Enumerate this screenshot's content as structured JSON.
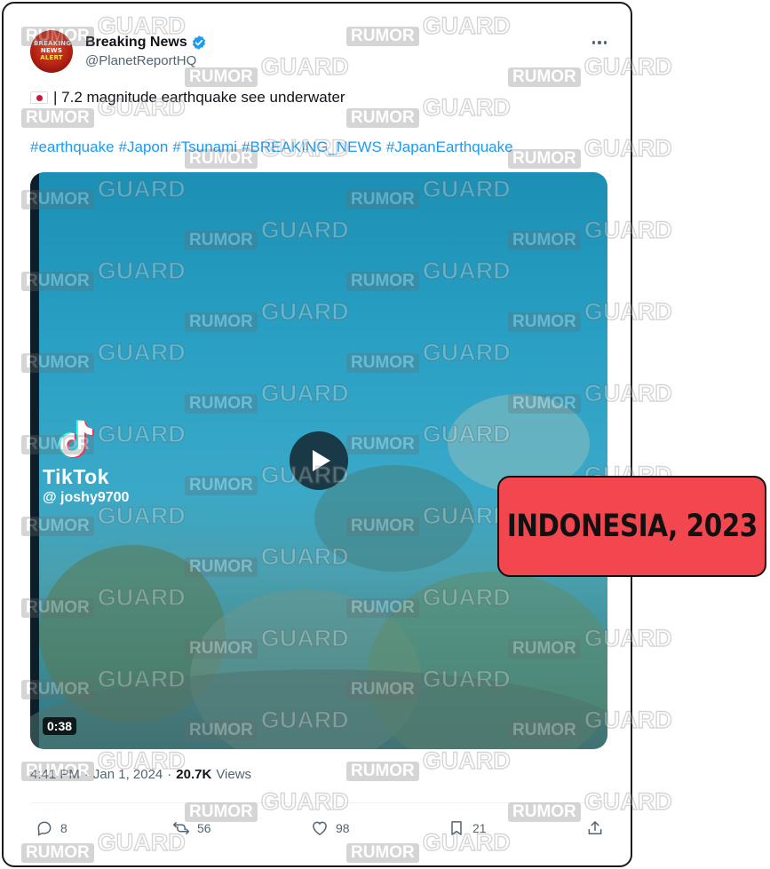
{
  "post": {
    "author": {
      "display_name": "Breaking News",
      "handle": "@PlanetReportHQ",
      "verified": true,
      "avatar_lines": [
        "BREAKING",
        "NEWS",
        "ALERT"
      ]
    },
    "text": "| 7.2 magnitude earthquake see underwater",
    "flag_icon": "japan-flag-icon",
    "hashtags": [
      "#earthquake",
      "#Japon",
      "#Tsunami",
      "#BREAKING_NEWS",
      "#JapanEarthquake"
    ],
    "media": {
      "tiktok_label": "TikTok",
      "tiktok_user": "@ joshy9700",
      "duration": "0:38"
    },
    "meta": {
      "time": "4:41 PM",
      "separator": "·",
      "date": "Jan 1, 2024",
      "views_count": "20.7K",
      "views_label": "Views"
    },
    "actions": {
      "replies": "8",
      "reposts": "56",
      "likes": "98",
      "bookmarks": "21"
    }
  },
  "overlay_label": "INDONESIA, 2023",
  "watermark": {
    "left_word": "RUMOR",
    "right_word": "GUARD"
  },
  "colors": {
    "link": "#1d9bf0",
    "label_bg": "#f2474e",
    "muted": "#536471",
    "verified": "#1d9bf0"
  }
}
